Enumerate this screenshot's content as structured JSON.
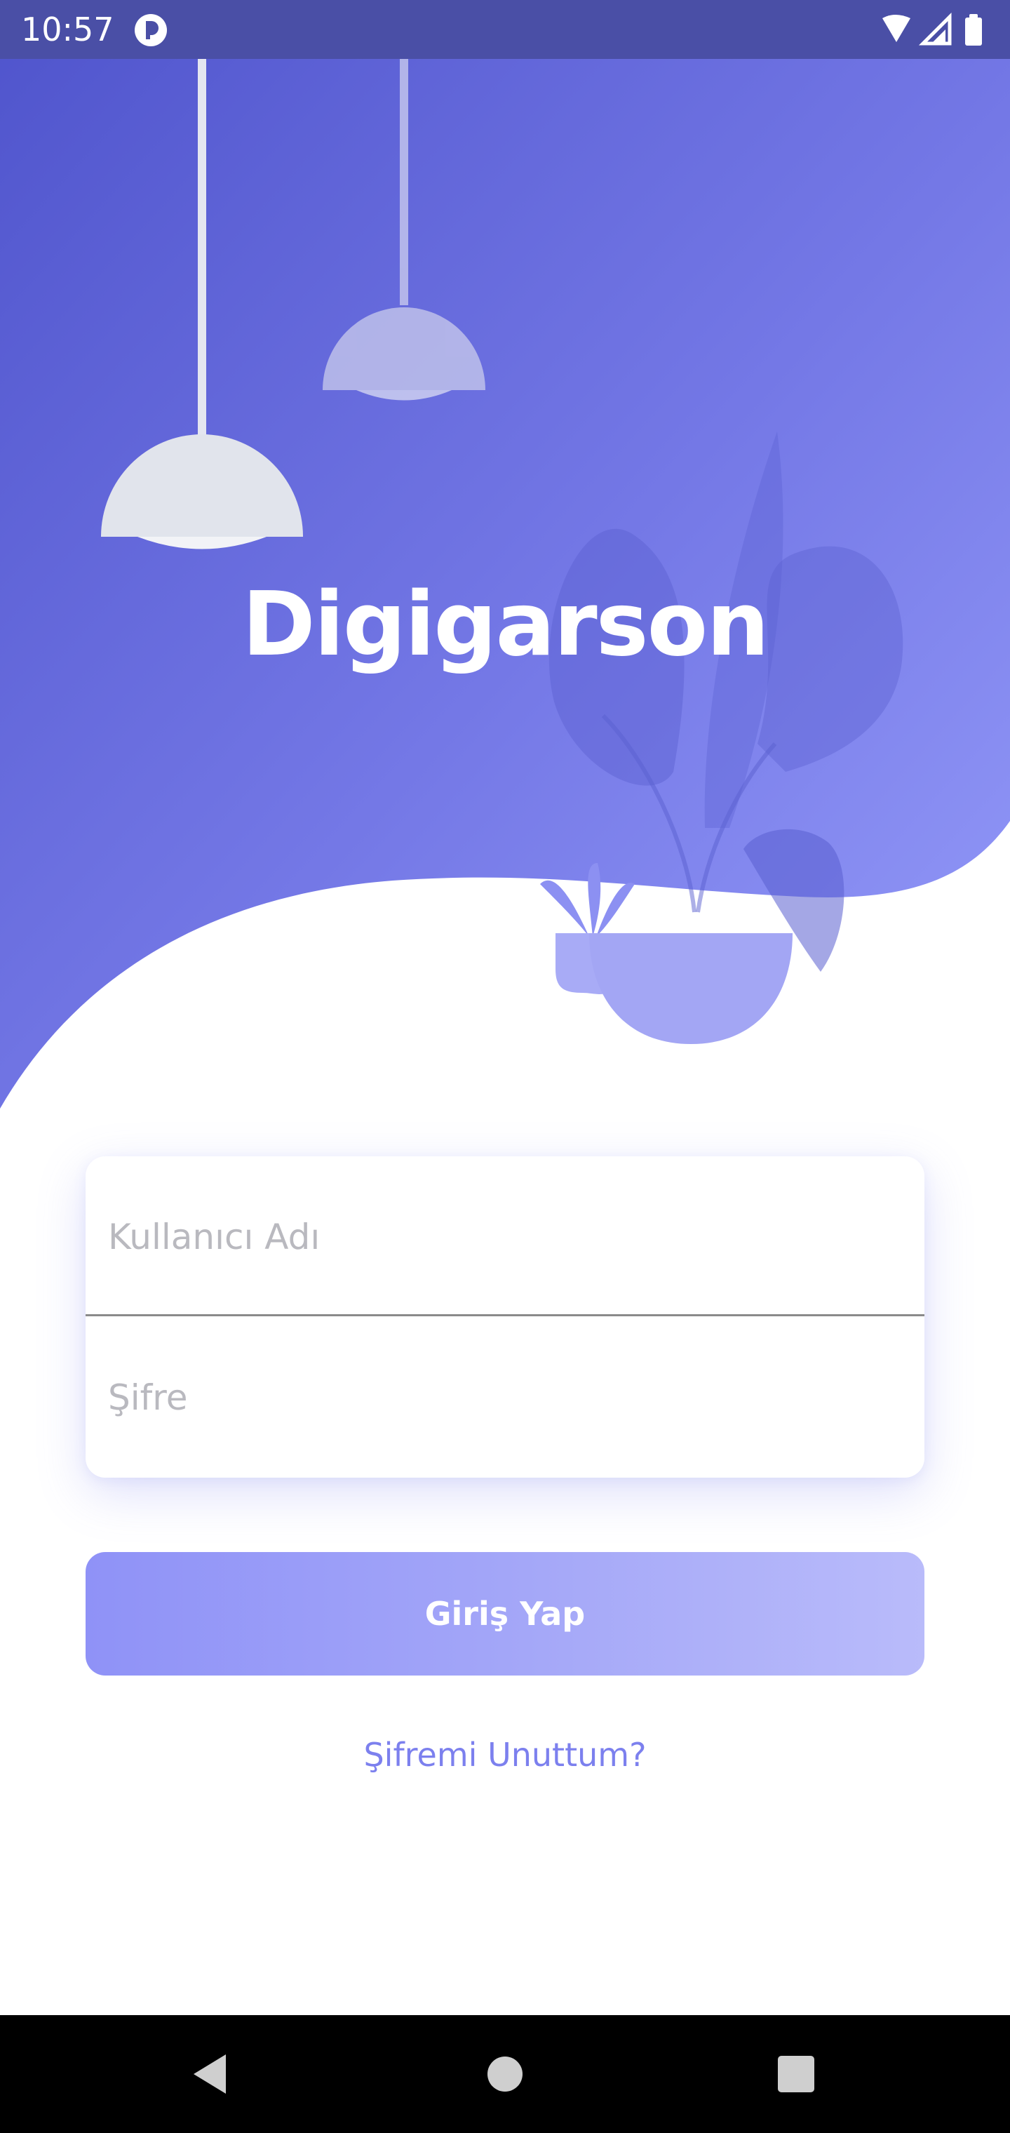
{
  "status_bar": {
    "time": "10:57",
    "app_icon": "app-notification-icon",
    "wifi_icon": "wifi-icon",
    "signal_icon": "cell-signal-icon",
    "battery_icon": "battery-icon"
  },
  "hero": {
    "title": "Digigarson",
    "gradient_start": "#4f54cc",
    "gradient_end": "#8f95f8",
    "illustrations": [
      "pendant-lamp-icon",
      "pendant-lamp-icon",
      "potted-plant-icon"
    ]
  },
  "login": {
    "username_placeholder": "Kullanıcı Adı",
    "password_placeholder": "Şifre",
    "submit_label": "Giriş Yap",
    "forgot_label": "Şifremi Unuttum?"
  },
  "nav_bar": {
    "back_icon": "back-triangle-icon",
    "home_icon": "home-circle-icon",
    "recents_icon": "recents-square-icon"
  },
  "colors": {
    "accent": "#7c80ee",
    "button_start": "#8f92f7",
    "button_end": "#b9bbfa",
    "status_bar": "#4a4fa6"
  }
}
